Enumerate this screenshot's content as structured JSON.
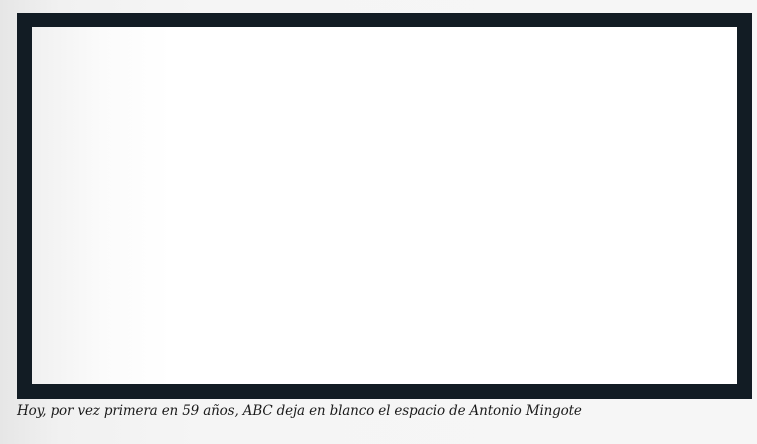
{
  "caption": "Hoy, por vez primera en 59 años, ABC deja en blanco el espacio de Antonio Mingote"
}
